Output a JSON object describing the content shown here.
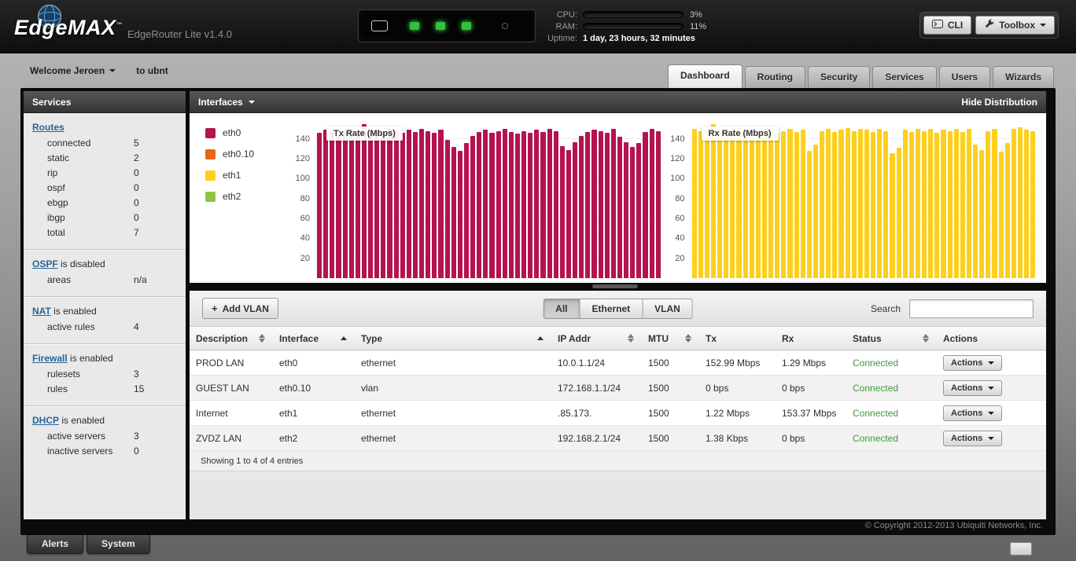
{
  "header": {
    "brand": "EdgeMAX",
    "brand_tm": "™",
    "subtitle": "EdgeRouter Lite v1.4.0",
    "device_leds": 3,
    "stats": {
      "cpu_label": "CPU:",
      "cpu_pct": "3%",
      "cpu_value": 3,
      "ram_label": "RAM:",
      "ram_pct": "11%",
      "ram_value": 11,
      "uptime_label": "Uptime:",
      "uptime_value": "1 day, 23 hours, 32 minutes"
    },
    "cli_button": "CLI",
    "toolbox_button": "Toolbox"
  },
  "nav": {
    "welcome": "Welcome Jeroen",
    "to_text": "to ubnt",
    "tabs": [
      {
        "label": "Dashboard",
        "active": true
      },
      {
        "label": "Routing"
      },
      {
        "label": "Security"
      },
      {
        "label": "Services"
      },
      {
        "label": "Users"
      },
      {
        "label": "Wizards"
      }
    ]
  },
  "sidebar": {
    "title": "Services",
    "sections": [
      {
        "link": "Routes",
        "status": "",
        "rows": [
          {
            "label": "connected",
            "value": "5"
          },
          {
            "label": "static",
            "value": "2"
          },
          {
            "label": "rip",
            "value": "0"
          },
          {
            "label": "ospf",
            "value": "0"
          },
          {
            "label": "ebgp",
            "value": "0"
          },
          {
            "label": "ibgp",
            "value": "0"
          },
          {
            "label": "total",
            "value": "7"
          }
        ]
      },
      {
        "link": "OSPF",
        "status": "is disabled",
        "rows": [
          {
            "label": "areas",
            "value": "n/a"
          }
        ]
      },
      {
        "link": "NAT",
        "status": "is enabled",
        "rows": [
          {
            "label": "active rules",
            "value": "4"
          }
        ]
      },
      {
        "link": "Firewall",
        "status": "is enabled",
        "rows": [
          {
            "label": "rulesets",
            "value": "3"
          },
          {
            "label": "rules",
            "value": "15"
          }
        ]
      },
      {
        "link": "DHCP",
        "status": "is enabled",
        "rows": [
          {
            "label": "active servers",
            "value": "3"
          },
          {
            "label": "inactive servers",
            "value": "0"
          }
        ]
      }
    ]
  },
  "main": {
    "panel_title": "Interfaces",
    "hide_distribution": "Hide Distribution",
    "legend": [
      {
        "label": "eth0",
        "color": "#b5134f"
      },
      {
        "label": "eth0.10",
        "color": "#e8680f"
      },
      {
        "label": "eth1",
        "color": "#fdd01e"
      },
      {
        "label": "eth2",
        "color": "#8dc63f"
      }
    ]
  },
  "chart_data": [
    {
      "type": "bar",
      "title": "Tx Rate (Mbps)",
      "color": "#b5134f",
      "yticks": [
        20,
        40,
        60,
        80,
        100,
        120,
        140
      ],
      "ylim": [
        0,
        158
      ],
      "values": [
        146,
        149,
        147,
        144,
        148,
        150,
        146,
        155,
        149,
        147,
        145,
        150,
        148,
        146,
        149,
        147,
        150,
        148,
        146,
        149,
        139,
        132,
        128,
        136,
        143,
        147,
        149,
        146,
        148,
        150,
        147,
        145,
        148,
        146,
        149,
        147,
        150,
        148,
        133,
        129,
        137,
        143,
        147,
        149,
        148,
        146,
        150,
        142,
        137,
        132,
        136,
        147,
        150,
        148
      ]
    },
    {
      "type": "bar",
      "title": "Rx Rate (Mbps)",
      "color": "#fdd01e",
      "yticks": [
        20,
        40,
        60,
        80,
        100,
        120,
        140
      ],
      "ylim": [
        0,
        158
      ],
      "values": [
        150,
        148,
        152,
        155,
        150,
        146,
        149,
        151,
        150,
        148,
        147,
        150,
        149,
        146,
        148,
        150,
        147,
        149,
        128,
        134,
        148,
        150,
        147,
        149,
        151,
        148,
        150,
        149,
        147,
        150,
        148,
        126,
        131,
        149,
        147,
        150,
        148,
        150,
        146,
        149,
        148,
        150,
        147,
        150,
        134,
        129,
        148,
        150,
        127,
        136,
        150,
        152,
        149,
        148
      ]
    }
  ],
  "toolbar": {
    "add_vlan": {
      "icon": "+",
      "label": "Add VLAN"
    },
    "filters": [
      {
        "label": "All",
        "active": true
      },
      {
        "label": "Ethernet"
      },
      {
        "label": "VLAN"
      }
    ],
    "search": {
      "label": "Search",
      "value": ""
    }
  },
  "table": {
    "columns": [
      {
        "label": "Description",
        "sort": "both"
      },
      {
        "label": "Interface",
        "sort": "asc"
      },
      {
        "label": "Type",
        "sort": "asc"
      },
      {
        "label": "IP Addr",
        "sort": "both"
      },
      {
        "label": "MTU",
        "sort": "both"
      },
      {
        "label": "Tx",
        "sort": "none"
      },
      {
        "label": "Rx",
        "sort": "none"
      },
      {
        "label": "Status",
        "sort": "both"
      },
      {
        "label": "Actions",
        "sort": "none"
      }
    ],
    "rows": [
      {
        "description": "PROD LAN",
        "interface": "eth0",
        "type": "ethernet",
        "ip": "10.0.1.1/24",
        "mtu": "1500",
        "tx": "152.99 Mbps",
        "rx": "1.29 Mbps",
        "status": "Connected",
        "action": "Actions"
      },
      {
        "description": "GUEST LAN",
        "interface": "eth0.10",
        "type": "vlan",
        "ip": "172.168.1.1/24",
        "mtu": "1500",
        "tx": "0 bps",
        "rx": "0 bps",
        "status": "Connected",
        "action": "Actions"
      },
      {
        "description": "Internet",
        "interface": "eth1",
        "type": "ethernet",
        "ip": ".85.173.",
        "mtu": "1500",
        "tx": "1.22 Mbps",
        "rx": "153.37 Mbps",
        "status": "Connected",
        "action": "Actions"
      },
      {
        "description": "ZVDZ LAN",
        "interface": "eth2",
        "type": "ethernet",
        "ip": "192.168.2.1/24",
        "mtu": "1500",
        "tx": "1.38 Kbps",
        "rx": "0 bps",
        "status": "Connected",
        "action": "Actions"
      }
    ],
    "footer": "Showing 1 to 4 of 4 entries"
  },
  "footer": {
    "copyright": "© Copyright 2012-2013 Ubiquiti Networks, Inc."
  },
  "bottom_bar": {
    "tabs": [
      "Alerts",
      "System"
    ]
  },
  "colors": {
    "connected": "#3d9b37",
    "link": "#2a6496"
  }
}
